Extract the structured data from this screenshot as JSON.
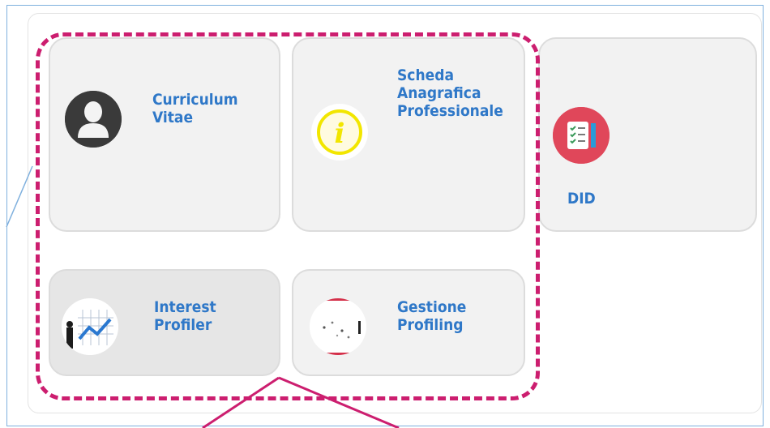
{
  "tiles": [
    {
      "label": "Curriculum\nVitae",
      "icon": "user-silhouette-icon"
    },
    {
      "label": "Scheda\nAnagrafica\nProfessionale",
      "icon": "info-icon"
    },
    {
      "label": "DID",
      "icon": "checklist-icon"
    },
    {
      "label": "Interest\nProfiler",
      "icon": "profiler-chart-icon"
    },
    {
      "label": "Gestione\nProfiling",
      "icon": "profiling-icon"
    }
  ],
  "colors": {
    "link": "#2f78c8",
    "highlight": "#cc1e6f",
    "frame": "#7fb0de",
    "info_yellow": "#f2e600",
    "did_red": "#e0475a"
  }
}
